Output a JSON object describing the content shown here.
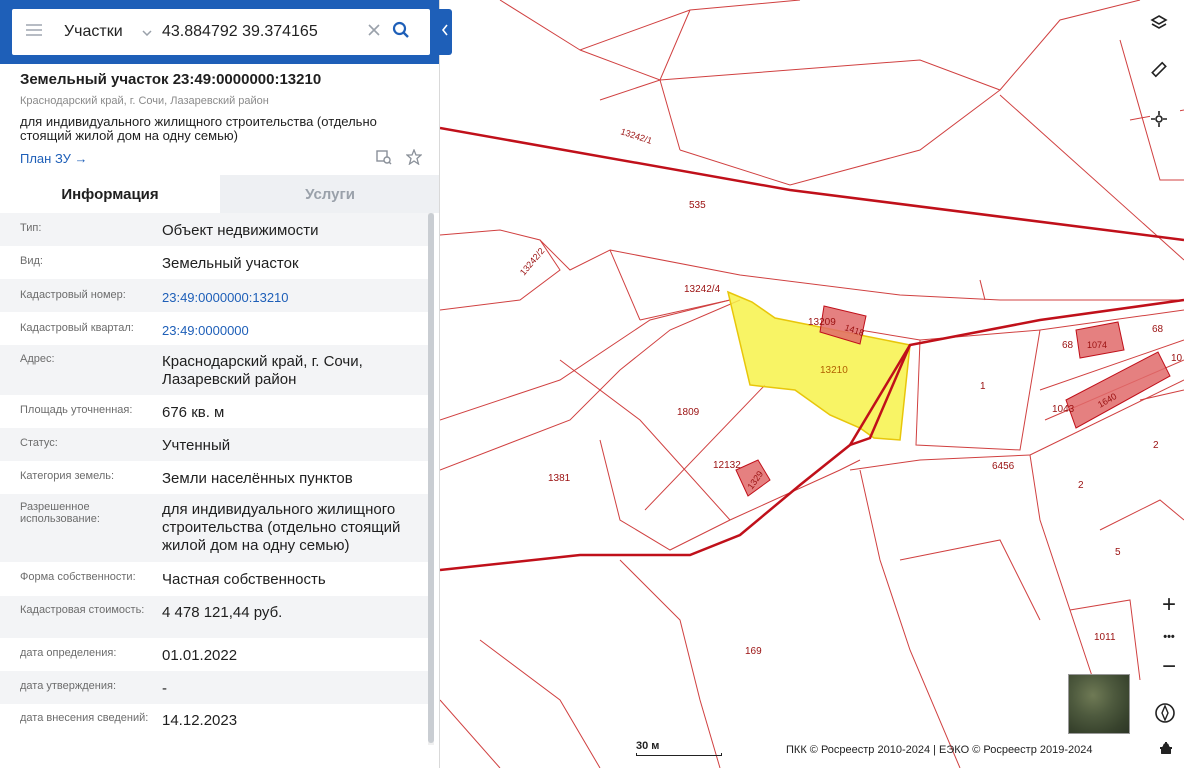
{
  "search": {
    "category": "Участки",
    "query": "43.884792 39.374165"
  },
  "object": {
    "title": "Земельный участок 23:49:0000000:13210",
    "region": "Краснодарский край, г. Сочи, Лазаревский район",
    "description": "для индивидуального жилищного строительства (отдельно стоящий жилой дом на одну семью)",
    "plan_link": "План ЗУ →"
  },
  "tabs": [
    {
      "label": "Информация",
      "active": true
    },
    {
      "label": "Услуги",
      "active": false
    }
  ],
  "rows": [
    {
      "label": "Тип:",
      "value": "Объект недвижимости"
    },
    {
      "label": "Вид:",
      "value": "Земельный участок"
    },
    {
      "label": "Кадастровый номер:",
      "value": "23:49:0000000:13210"
    },
    {
      "label": "Кадастровый квартал:",
      "value": "23:49:0000000"
    },
    {
      "label": "Адрес:",
      "value": "Краснодарский край, г. Сочи, Лазаревский район"
    },
    {
      "label": "Площадь уточненная:",
      "value": "676 кв. м"
    },
    {
      "label": "Статус:",
      "value": "Учтенный"
    },
    {
      "label": "Категория земель:",
      "value": "Земли населённых пунктов"
    },
    {
      "label": "Разрешенное использование:",
      "value": "для индивидуального жилищного строительства (отдельно стоящий жилой дом на одну семью)"
    },
    {
      "label": "Форма собственности:",
      "value": "Частная собственность"
    },
    {
      "label": "Кадастровая стоимость:",
      "value": "4 478 121,44 руб."
    },
    {
      "label": "дата определения:",
      "value": "01.01.2022"
    },
    {
      "label": "дата утверждения:",
      "value": "-"
    },
    {
      "label": "дата внесения сведений:",
      "value": "14.12.2023"
    }
  ],
  "map": {
    "parcel_labels": {
      "p13242_1": "13242/1",
      "p535": "535",
      "p13242_2": "13242/2",
      "p13242_4": "13242/4",
      "p13209": "13209",
      "p1418": "1418",
      "p13210": "13210",
      "p1809": "1809",
      "p12132": "12132",
      "p1329": "1329",
      "p1381": "1381",
      "p169": "169",
      "p1": "1",
      "p6456": "6456",
      "p2a": "2",
      "p2b": "2",
      "p5": "5",
      "p1011": "1011",
      "p1043": "1043",
      "p1640": "1640",
      "p68a": "68",
      "p68b": "68",
      "p1074": "1074",
      "p10": "10"
    },
    "scale_label": "30 м",
    "copyright": "ПКК © Росреестр 2010-2024 | ЕЭКО © Росреестр 2019-2024",
    "zoom_in": "+",
    "more": "•••",
    "zoom_out": "−"
  },
  "colors": {
    "brand": "#1e5fb8",
    "boundary": "#c0101a",
    "selected_fill": "#f7f24a",
    "building_fill": "#e06a6a"
  }
}
